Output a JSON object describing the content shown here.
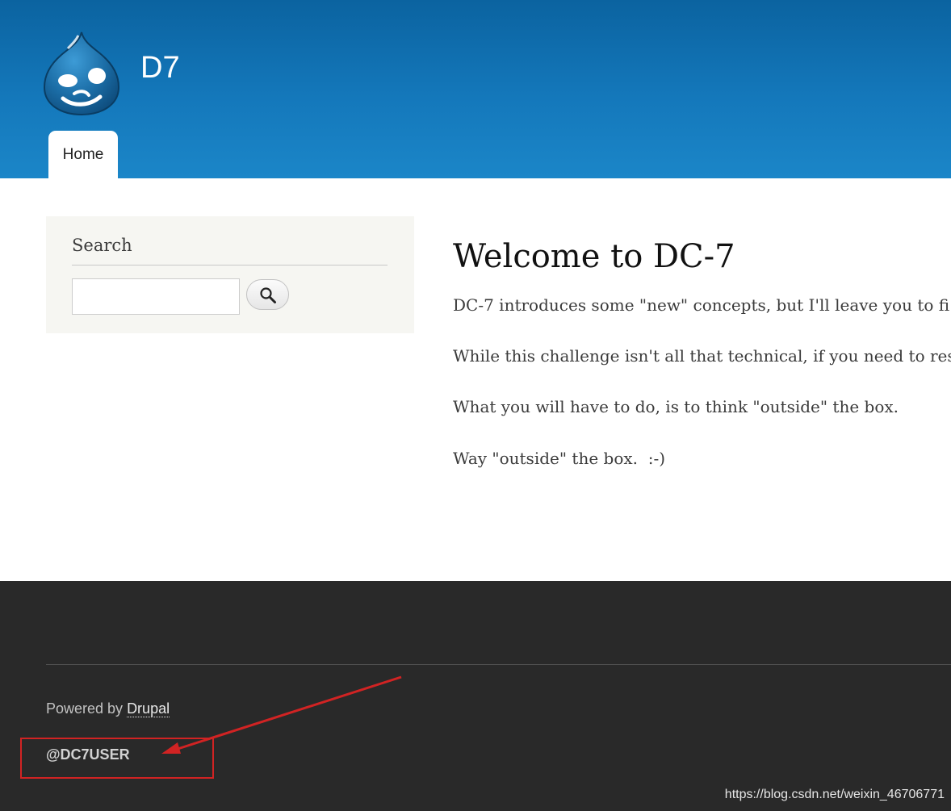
{
  "header": {
    "site_name": "D7",
    "nav": [
      {
        "label": "Home"
      }
    ]
  },
  "sidebar": {
    "search_block": {
      "title": "Search",
      "input_value": "",
      "button_icon": "search-icon"
    }
  },
  "main": {
    "title": "Welcome to DC-7",
    "paragraphs": [
      "DC-7 introduces some \"new\" concepts, but I'll leave you to fi",
      "While this challenge isn't all that technical, if you need to res",
      "What you will have to do, is to think \"outside\" the box.",
      "Way \"outside\" the box.  :-)"
    ]
  },
  "footer": {
    "powered_by_prefix": "Powered by ",
    "powered_by_link": "Drupal",
    "user_handle": "@DC7USER",
    "watermark": "https://blog.csdn.net/weixin_46706771"
  },
  "colors": {
    "header_blue": "#1478bb",
    "footer_bg": "#292929",
    "annotation_red": "#d12323"
  }
}
